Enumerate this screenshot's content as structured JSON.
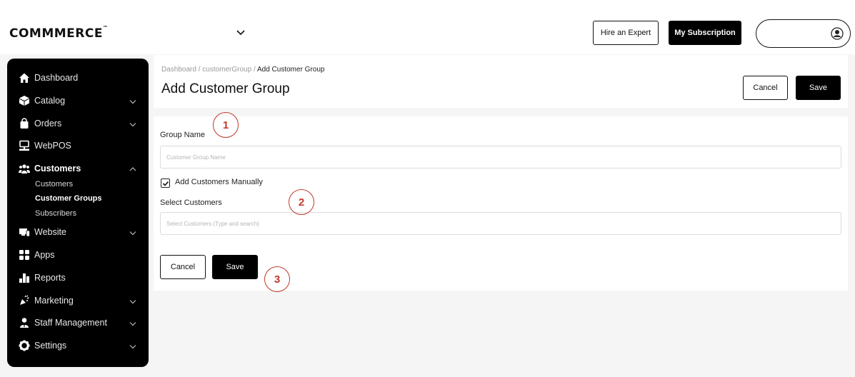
{
  "topbar": {
    "logo": "COMMMERCE",
    "logo_tm": "™",
    "hire_expert": "Hire an Expert",
    "my_subscription": "My Subscription"
  },
  "sidebar": {
    "items": [
      {
        "label": "Dashboard",
        "icon": "home-icon"
      },
      {
        "label": "Catalog",
        "icon": "box-icon"
      },
      {
        "label": "Orders",
        "icon": "bag-icon"
      },
      {
        "label": "WebPOS",
        "icon": "pos-icon"
      },
      {
        "label": "Customers",
        "icon": "users-icon"
      },
      {
        "label": "Website",
        "icon": "website-icon"
      },
      {
        "label": "Apps",
        "icon": "apps-icon"
      },
      {
        "label": "Reports",
        "icon": "reports-icon"
      },
      {
        "label": "Marketing",
        "icon": "megaphone-icon"
      },
      {
        "label": "Staff Management",
        "icon": "staff-icon"
      },
      {
        "label": "Settings",
        "icon": "gear-icon"
      }
    ],
    "customers_sub": [
      "Customers",
      "Customer Groups",
      "Subscribers"
    ]
  },
  "header": {
    "breadcrumb_1": "Dashboard",
    "breadcrumb_sep": " / ",
    "breadcrumb_2": "customerGroup",
    "breadcrumb_3": "Add Customer Group",
    "title": "Add Customer Group",
    "cancel": "Cancel",
    "save": "Save"
  },
  "form": {
    "group_name_label": "Group Name",
    "group_name_placeholder": "Customer Group Name",
    "add_manually_label": "Add Customers Manually",
    "add_manually_checked": true,
    "select_customers_label": "Select Customers",
    "select_customers_placeholder": "Select Customers (Type and search)",
    "cancel": "Cancel",
    "save": "Save"
  },
  "callouts": [
    "1",
    "2",
    "3"
  ],
  "colors": {
    "callout": "#c0392b",
    "sidebar_bg": "#000000",
    "page_bg": "#f5f5f5"
  }
}
